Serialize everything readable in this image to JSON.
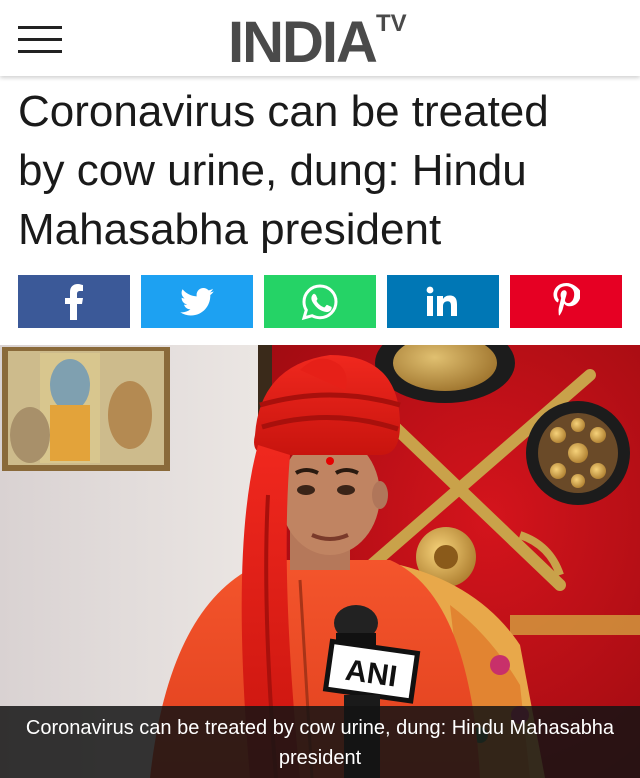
{
  "header": {
    "menu_icon": "hamburger-menu-icon",
    "logo_text": "INDIA",
    "logo_superscript": "TV"
  },
  "article": {
    "headline_line1": "Coronavirus can be treated",
    "headline_line2": "by cow urine, dung: Hindu",
    "headline_line3": "Mahasabha president"
  },
  "share": {
    "buttons": [
      {
        "name": "facebook",
        "icon": "facebook-icon",
        "color": "#3b5998"
      },
      {
        "name": "twitter",
        "icon": "twitter-icon",
        "color": "#1da1f2"
      },
      {
        "name": "whatsapp",
        "icon": "whatsapp-icon",
        "color": "#25d366"
      },
      {
        "name": "linkedin",
        "icon": "linkedin-icon",
        "color": "#0077b5"
      },
      {
        "name": "pinterest",
        "icon": "pinterest-icon",
        "color": "#e60023"
      }
    ]
  },
  "photo": {
    "mic_label": "ANI",
    "caption": "Coronavirus can be treated by cow urine, dung: Hindu Mahasabha president"
  },
  "colors": {
    "header_bg": "#ffffff",
    "headline_text": "#1a1a1a",
    "logo_text": "#4a4a4a",
    "caption_bg": "#141414",
    "caption_text": "#ffffff"
  }
}
